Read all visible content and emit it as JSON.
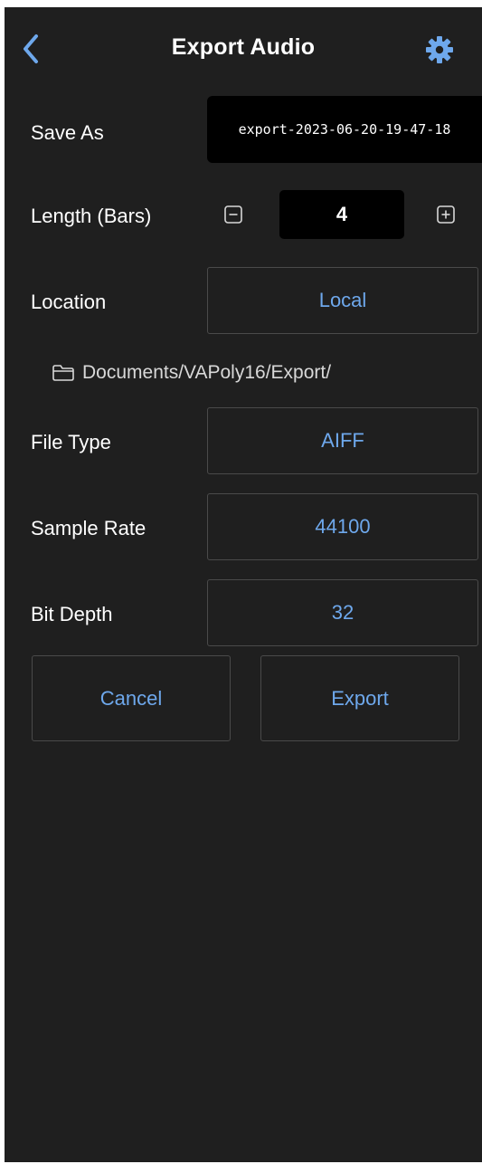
{
  "header": {
    "title": "Export Audio",
    "back_icon": "chevron-left-icon",
    "settings_icon": "gear-icon"
  },
  "form": {
    "save_as": {
      "label": "Save As",
      "value": "export-2023-06-20-19-47-18"
    },
    "length": {
      "label": "Length (Bars)",
      "value": "4",
      "decrement_icon": "minus-square-icon",
      "increment_icon": "plus-square-icon"
    },
    "location": {
      "label": "Location",
      "value": "Local",
      "path": "Documents/VAPoly16/Export/",
      "path_icon": "folder-icon"
    },
    "file_type": {
      "label": "File Type",
      "value": "AIFF"
    },
    "sample_rate": {
      "label": "Sample Rate",
      "value": "44100"
    },
    "bit_depth": {
      "label": "Bit Depth",
      "value": "32"
    }
  },
  "actions": {
    "cancel_label": "Cancel",
    "export_label": "Export"
  },
  "colors": {
    "background": "#1f1f1f",
    "accent": "#6ea8ec",
    "field": "#000000",
    "border": "#4a4a4a"
  }
}
